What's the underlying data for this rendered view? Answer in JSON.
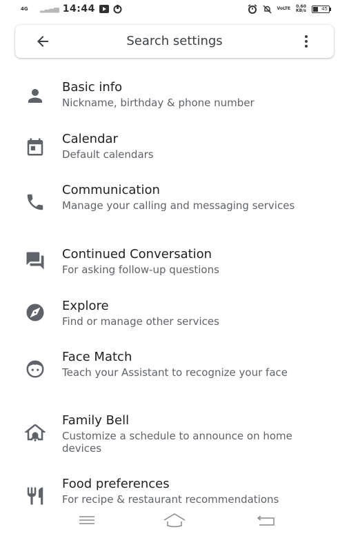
{
  "status_bar": {
    "network_label": "4G",
    "time": "14:44",
    "volte_label": "VoLTE",
    "speed": "0.60",
    "speed_unit": "KB/s",
    "battery": "45"
  },
  "search": {
    "placeholder": "Search settings"
  },
  "items": [
    {
      "title": "Basic info",
      "subtitle": "Nickname, birthday & phone number",
      "icon": "person-icon"
    },
    {
      "title": "Calendar",
      "subtitle": "Default calendars",
      "icon": "calendar-icon"
    },
    {
      "title": "Communication",
      "subtitle": "Manage your calling and messaging services",
      "icon": "phone-icon"
    },
    {
      "title": "Continued Conversation",
      "subtitle": "For asking follow-up questions",
      "icon": "chat-icon"
    },
    {
      "title": "Explore",
      "subtitle": "Find or manage other services",
      "icon": "compass-icon"
    },
    {
      "title": "Face Match",
      "subtitle": "Teach your Assistant to recognize your face",
      "icon": "face-icon"
    },
    {
      "title": "Family Bell",
      "subtitle": "Customize a schedule to announce on home devices",
      "icon": "home-bell-icon"
    },
    {
      "title": "Food preferences",
      "subtitle": "For recipe & restaurant recommendations",
      "icon": "restaurant-icon"
    }
  ],
  "colors": {
    "text_primary": "#202124",
    "text_secondary": "#5f6368",
    "icon": "#5f6368"
  }
}
